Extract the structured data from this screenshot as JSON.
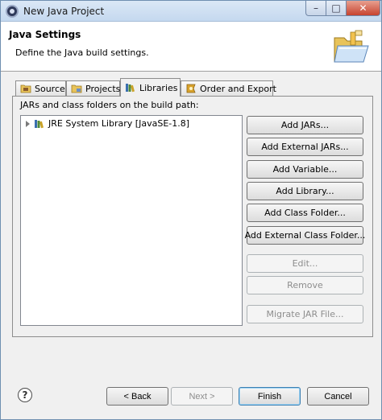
{
  "window": {
    "title": "New Java Project",
    "controls": {
      "minimize": "–",
      "maximize": "□",
      "close": "✕"
    }
  },
  "header": {
    "title": "Java Settings",
    "description": "Define the Java build settings."
  },
  "tabs": [
    {
      "label": "Source",
      "icon": "source-folder-icon",
      "active": false
    },
    {
      "label": "Projects",
      "icon": "projects-icon",
      "active": false
    },
    {
      "label": "Libraries",
      "icon": "libraries-icon",
      "active": true
    },
    {
      "label": "Order and Export",
      "icon": "order-export-icon",
      "active": false
    }
  ],
  "libraries": {
    "list_label": "JARs and class folders on the build path:",
    "entries": [
      {
        "label": "JRE System Library [JavaSE-1.8]",
        "icon": "library-icon",
        "expanded": false
      }
    ],
    "buttons": {
      "add_jars": "Add JARs...",
      "add_external_jars": "Add External JARs...",
      "add_variable": "Add Variable...",
      "add_library": "Add Library...",
      "add_class_folder": "Add Class Folder...",
      "add_external_class_folder": "Add External Class Folder...",
      "edit": "Edit...",
      "remove": "Remove",
      "migrate_jar": "Migrate JAR File..."
    }
  },
  "footer": {
    "help": "?",
    "back": "< Back",
    "next": "Next >",
    "finish": "Finish",
    "cancel": "Cancel"
  }
}
